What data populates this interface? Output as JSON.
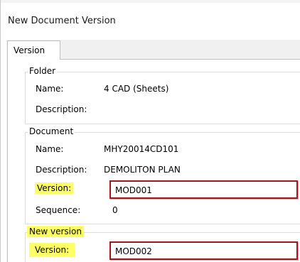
{
  "window": {
    "title": "New Document Version"
  },
  "tabs": [
    {
      "label": "Version"
    }
  ],
  "folder": {
    "legend": "Folder",
    "name_label": "Name:",
    "name_value": "4 CAD (Sheets)",
    "description_label": "Description:",
    "description_value": ""
  },
  "document": {
    "legend": "Document",
    "name_label": "Name:",
    "name_value": "MHY20014CD101",
    "description_label": "Description:",
    "description_value": "DEMOLITON PLAN",
    "version_label": "Version:",
    "version_value": "MOD001",
    "sequence_label": "Sequence:",
    "sequence_value": "0"
  },
  "new_version": {
    "legend": "New version",
    "version_label": "Version:",
    "version_value": "MOD002"
  },
  "colors": {
    "highlight": "#ffff66",
    "annotation_border": "#a4161a",
    "tab_background": "#f0f0f0"
  }
}
